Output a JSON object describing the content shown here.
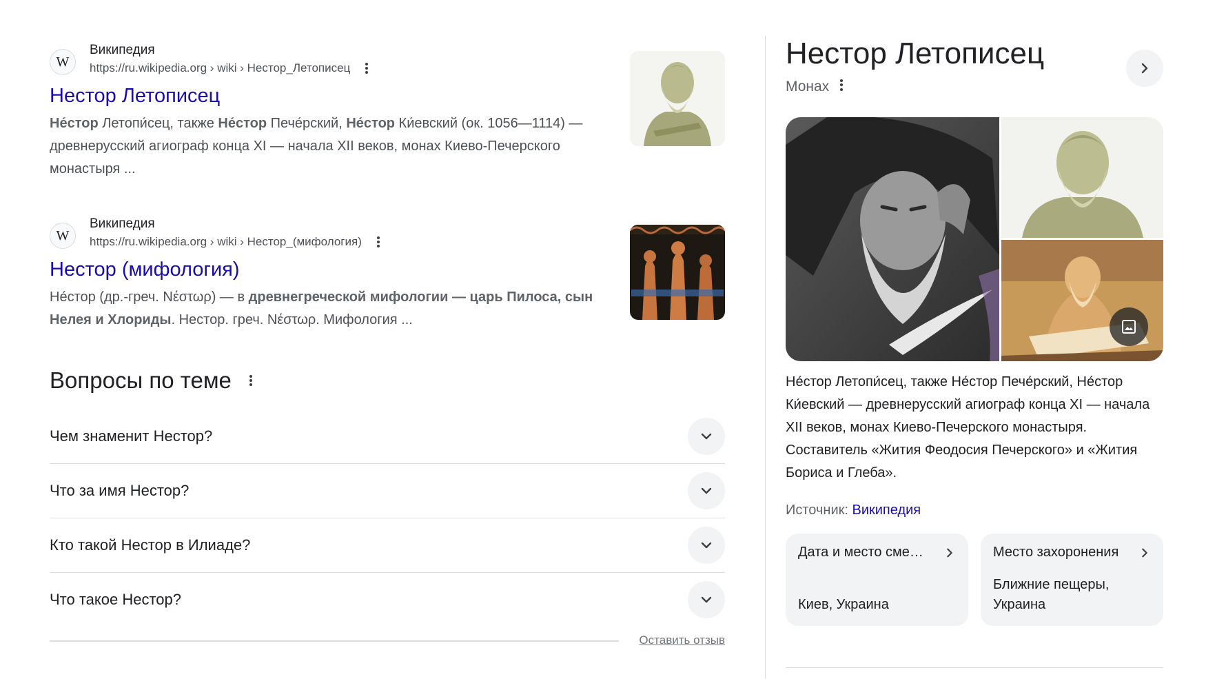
{
  "results": [
    {
      "source_name": "Википедия",
      "favicon_letter": "W",
      "url": "https://ru.wikipedia.org › wiki › Нестор_Летописец",
      "title": "Нестор Летописец",
      "snippet": [
        {
          "b": true,
          "t": "Не́стор"
        },
        {
          "b": false,
          "t": " Летопи́сец, также "
        },
        {
          "b": true,
          "t": "Не́стор"
        },
        {
          "b": false,
          "t": " Пече́рский, "
        },
        {
          "b": true,
          "t": "Не́стор"
        },
        {
          "b": false,
          "t": " Ки́евский (ок. 1056—1114) — древнерусский агиограф конца XI — начала XII веков, монах Киево-Печерского монастыря ..."
        }
      ]
    },
    {
      "source_name": "Википедия",
      "favicon_letter": "W",
      "url": "https://ru.wikipedia.org › wiki › Нестор_(мифология)",
      "title": "Нестор (мифология)",
      "snippet": [
        {
          "b": false,
          "t": "Не́стор (др.-греч. Νέστωρ) — в "
        },
        {
          "b": true,
          "t": "древнегреческой мифологии — царь Пилоса, сын Нелея и Хлориды"
        },
        {
          "b": false,
          "t": ". Нестор. греч. Νέστωρ. Мифология ..."
        }
      ]
    }
  ],
  "paa": {
    "title": "Вопросы по теме",
    "questions": [
      "Чем знаменит Нестор?",
      "Что за имя Нестор?",
      "Кто такой Нестор в Илиаде?",
      "Что такое Нестор?"
    ],
    "feedback": "Оставить отзыв"
  },
  "knowledge_panel": {
    "title": "Нестор Летописец",
    "subtitle": "Монах",
    "description": "Не́стор Летопи́сец, также Не́стор Пече́рский, Не́стор Ки́евский — древнерусский агиограф конца XI — начала XII веков, монах Киево-Печерского монастыря. Составитель «Жития Феодосия Печерского» и «Жития Бориса и Глеба».",
    "source_label": "Источник: ",
    "source_link": "Википедия",
    "cards": [
      {
        "label": "Дата и место сме…",
        "value": "Киев, Украина"
      },
      {
        "label": "Место захоронения",
        "value": "Ближние пещеры, Украина"
      }
    ]
  },
  "icons": {
    "kebab": "more-vert-icon",
    "chevron_down": "chevron-down-icon",
    "chevron_right": "chevron-right-icon",
    "photo": "image-icon"
  },
  "colors": {
    "link": "#1a0dab",
    "text": "#202124",
    "muted": "#4d5156",
    "chip_bg": "#f1f3f4",
    "divider": "#dadce0"
  }
}
